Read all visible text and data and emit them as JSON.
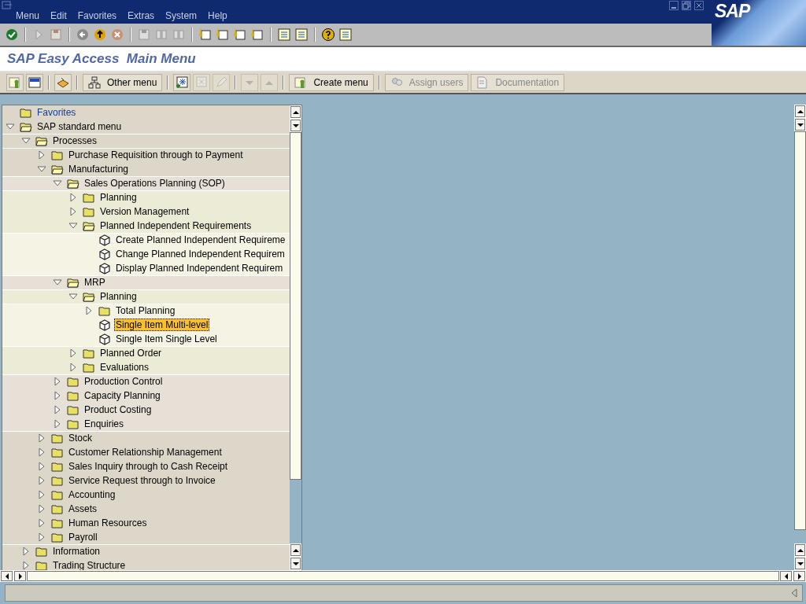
{
  "window": {
    "menu": [
      "Menu",
      "Edit",
      "Favorites",
      "Extras",
      "System",
      "Help"
    ],
    "logo": "SAP"
  },
  "title": "SAP Easy Access  Main Menu",
  "app_toolbar": [
    {
      "label": "Other menu",
      "disabled": false
    },
    {
      "label": "Create menu",
      "disabled": false
    },
    {
      "label": "Assign users",
      "disabled": true
    },
    {
      "label": "Documentation",
      "disabled": true
    }
  ],
  "tree": [
    {
      "label": "Favorites",
      "kind": "folder",
      "link": true,
      "selected": false
    },
    {
      "label": "SAP standard menu",
      "kind": "folder",
      "expanded": true,
      "selected": false,
      "children": [
        {
          "label": "Processes",
          "kind": "folder",
          "expanded": true,
          "selected": false,
          "children": [
            {
              "label": "Purchase Requisition through to Payment",
              "kind": "folder",
              "expanded": false,
              "selected": false
            },
            {
              "label": "Manufacturing",
              "kind": "folder",
              "expanded": true,
              "selected": false,
              "children": [
                {
                  "label": "Sales Operations Planning (SOP)",
                  "kind": "folder",
                  "expanded": true,
                  "selected": false,
                  "children": [
                    {
                      "label": "Planning",
                      "kind": "folder",
                      "expanded": false,
                      "selected": false
                    },
                    {
                      "label": "Version Management",
                      "kind": "folder",
                      "expanded": false,
                      "selected": false
                    },
                    {
                      "label": "Planned Independent Requirements",
                      "kind": "folder",
                      "expanded": true,
                      "selected": false,
                      "children": [
                        {
                          "label": "Create Planned Independent Requireme",
                          "kind": "transaction",
                          "selected": false
                        },
                        {
                          "label": "Change Planned Independent Requirem",
                          "kind": "transaction",
                          "selected": false
                        },
                        {
                          "label": "Display Planned Independent Requirem",
                          "kind": "transaction",
                          "selected": false
                        }
                      ]
                    }
                  ]
                },
                {
                  "label": "MRP",
                  "kind": "folder",
                  "expanded": true,
                  "selected": false,
                  "children": [
                    {
                      "label": "Planning",
                      "kind": "folder",
                      "expanded": true,
                      "selected": false,
                      "children": [
                        {
                          "label": "Total Planning",
                          "kind": "folder",
                          "expanded": false,
                          "selected": false
                        },
                        {
                          "label": "Single Item Multi-level",
                          "kind": "transaction",
                          "selected": true
                        },
                        {
                          "label": "Single Item Single Level",
                          "kind": "transaction",
                          "selected": false
                        }
                      ]
                    },
                    {
                      "label": "Planned Order",
                      "kind": "folder",
                      "expanded": false,
                      "selected": false
                    },
                    {
                      "label": "Evaluations",
                      "kind": "folder",
                      "expanded": false,
                      "selected": false
                    }
                  ]
                },
                {
                  "label": "Production Control",
                  "kind": "folder",
                  "expanded": false,
                  "selected": false
                },
                {
                  "label": "Capacity Planning",
                  "kind": "folder",
                  "expanded": false,
                  "selected": false
                },
                {
                  "label": "Product Costing",
                  "kind": "folder",
                  "expanded": false,
                  "selected": false
                },
                {
                  "label": "Enquiries",
                  "kind": "folder",
                  "expanded": false,
                  "selected": false
                }
              ]
            },
            {
              "label": "Stock",
              "kind": "folder",
              "expanded": false,
              "selected": false
            },
            {
              "label": "Customer Relationship Management",
              "kind": "folder",
              "expanded": false,
              "selected": false
            },
            {
              "label": "Sales Inquiry through to Cash Receipt",
              "kind": "folder",
              "expanded": false,
              "selected": false
            },
            {
              "label": "Service Request through to Invoice",
              "kind": "folder",
              "expanded": false,
              "selected": false
            },
            {
              "label": "Accounting",
              "kind": "folder",
              "expanded": false,
              "selected": false
            },
            {
              "label": "Assets",
              "kind": "folder",
              "expanded": false,
              "selected": false
            },
            {
              "label": "Human Resources",
              "kind": "folder",
              "expanded": false,
              "selected": false
            },
            {
              "label": "Payroll",
              "kind": "folder",
              "expanded": false,
              "selected": false
            }
          ]
        },
        {
          "label": "Information",
          "kind": "folder",
          "expanded": false,
          "selected": false
        },
        {
          "label": "Trading Structure",
          "kind": "folder",
          "expanded": false,
          "selected": false
        }
      ]
    }
  ]
}
